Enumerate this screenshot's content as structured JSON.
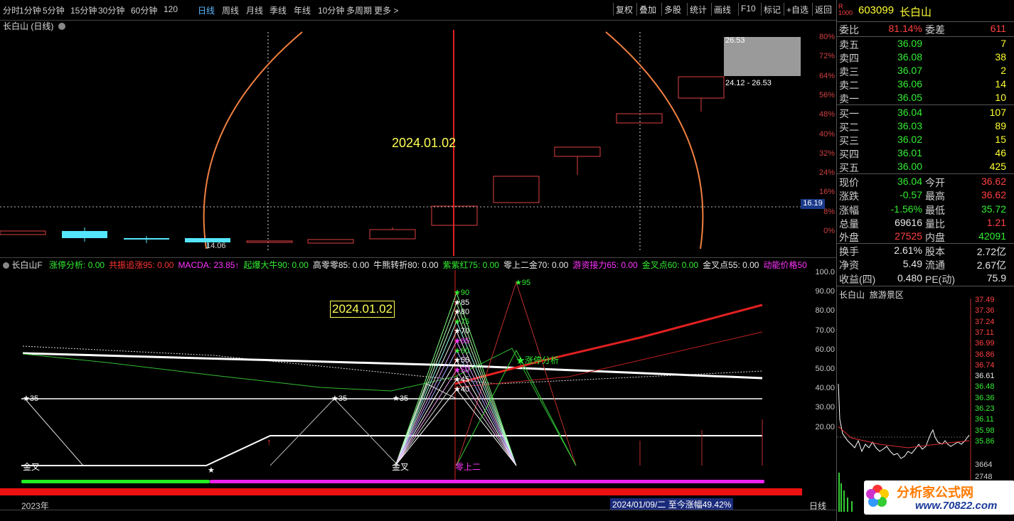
{
  "toolbar": {
    "periods": [
      "分时",
      "1分钟",
      "5分钟",
      "15分钟",
      "30分钟",
      "60分钟",
      "120",
      "日线",
      "周线",
      "月线",
      "季线",
      "年线",
      "10分钟",
      "多周期",
      "更多 >"
    ],
    "right_buttons": [
      "复权",
      "叠加",
      "多股",
      "统计",
      "画线",
      "F10",
      "标记",
      "+自选",
      "返回"
    ]
  },
  "main_chart": {
    "title": "长白山 (日线)",
    "date_label": "2024.01.02",
    "low_label": "14.06",
    "box_top": "26.53",
    "box_range": "24.12 - 26.53",
    "price_tag": "16.19",
    "right_axis": [
      "80%",
      "72%",
      "64%",
      "56%",
      "48%",
      "40%",
      "32%",
      "24%",
      "16%",
      "8%",
      "0%"
    ]
  },
  "indicator": {
    "name": "长白山F",
    "items": [
      {
        "label": "涨停分析: 0.00",
        "color": "#33ee33"
      },
      {
        "label": "共振追涨95: 0.00",
        "color": "#ff3333"
      },
      {
        "label": "MACDA: 23.85↑",
        "color": "#ff33ff"
      },
      {
        "label": "起爆大牛90: 0.00",
        "color": "#33ee33"
      },
      {
        "label": "高零零85: 0.00",
        "color": "#e8e8e8"
      },
      {
        "label": "牛熊转折80: 0.00",
        "color": "#e8e8e8"
      },
      {
        "label": "紫紫红75: 0.00",
        "color": "#33ee33"
      },
      {
        "label": "零上二金70: 0.00",
        "color": "#e8e8e8"
      },
      {
        "label": "游资接力65: 0.00",
        "color": "#ff33ff"
      },
      {
        "label": "金叉点60: 0.00",
        "color": "#33ee33"
      },
      {
        "label": "金叉点55: 0.00",
        "color": "#e8e8e8"
      },
      {
        "label": "动能价格50",
        "color": "#ff33ff"
      }
    ],
    "date_label": "2024.01.02",
    "right_axis": [
      "100.0",
      "90.00",
      "80.00",
      "70.00",
      "60.00",
      "50.00",
      "40.00",
      "30.00",
      "20.00"
    ],
    "star_labels": [
      "90",
      "85",
      "80",
      "75",
      "70",
      "65",
      "60",
      "55",
      "50",
      "45",
      "40"
    ],
    "star35": "35",
    "star95": "95",
    "limit_label": "涨停分析",
    "jincha": "金叉",
    "lingshanger": "零上二"
  },
  "bottom": {
    "year": "2023年",
    "info": "2024/01/09/二  至今涨幅49.42%",
    "period": "日线"
  },
  "quote": {
    "code": "603099",
    "name": "长白山",
    "weibi_label": "委比",
    "weibi": "81.14%",
    "weicha_label": "委差",
    "weicha": "611",
    "sells": [
      {
        "label": "卖五",
        "price": "36.09",
        "vol": "7"
      },
      {
        "label": "卖四",
        "price": "36.08",
        "vol": "38"
      },
      {
        "label": "卖三",
        "price": "36.07",
        "vol": "2"
      },
      {
        "label": "卖二",
        "price": "36.06",
        "vol": "14"
      },
      {
        "label": "卖一",
        "price": "36.05",
        "vol": "10"
      }
    ],
    "buys": [
      {
        "label": "买一",
        "price": "36.04",
        "vol": "107"
      },
      {
        "label": "买二",
        "price": "36.03",
        "vol": "89"
      },
      {
        "label": "买三",
        "price": "36.02",
        "vol": "15"
      },
      {
        "label": "买四",
        "price": "36.01",
        "vol": "46"
      },
      {
        "label": "买五",
        "price": "36.00",
        "vol": "425"
      }
    ],
    "stats": [
      {
        "l": "现价",
        "v": "36.04",
        "vc": "grn",
        "l2": "今开",
        "v2": "36.62",
        "v2c": "red"
      },
      {
        "l": "涨跌",
        "v": "-0.57",
        "vc": "grn",
        "l2": "最高",
        "v2": "36.62",
        "v2c": "red"
      },
      {
        "l": "涨幅",
        "v": "-1.56%",
        "vc": "grn",
        "l2": "最低",
        "v2": "35.72",
        "v2c": "grn"
      },
      {
        "l": "总量",
        "v": "69616",
        "vc": "wh",
        "l2": "量比",
        "v2": "1.21",
        "v2c": "red"
      },
      {
        "l": "外盘",
        "v": "27525",
        "vc": "red",
        "l2": "内盘",
        "v2": "42091",
        "v2c": "grn"
      }
    ],
    "stats2": [
      {
        "l": "换手",
        "v": "2.61%",
        "l2": "股本",
        "v2": "2.72亿"
      },
      {
        "l": "净资",
        "v": "5.49",
        "l2": "流通",
        "v2": "2.67亿"
      },
      {
        "l": "收益(四)",
        "v": "0.480",
        "l2": "PE(动)",
        "v2": "75.9"
      }
    ],
    "mini_title": "长白山",
    "mini_sector": "旅游景区",
    "mini_axis": [
      "37.49",
      "37.36",
      "37.24",
      "37.11",
      "36.99",
      "36.86",
      "36.74",
      "36.61",
      "36.48",
      "36.36",
      "36.23",
      "36.11",
      "35.98",
      "35.86"
    ],
    "mini_vol": "3664",
    "mini_vol2": "2748",
    "logo_text": "分析家公式网",
    "logo_url": "www.70822.com"
  }
}
